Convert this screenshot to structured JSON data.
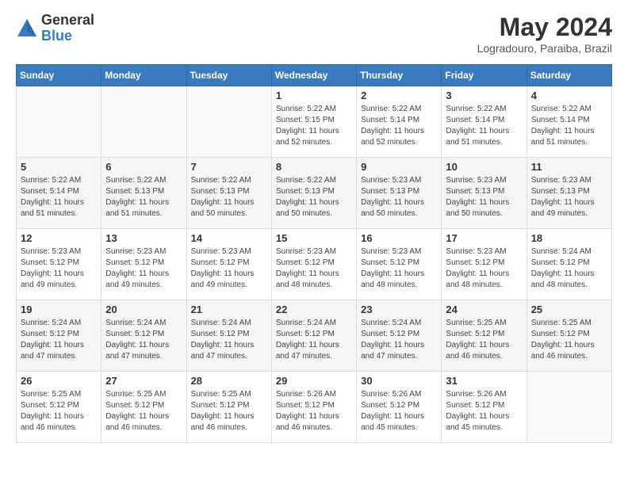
{
  "logo": {
    "general": "General",
    "blue": "Blue"
  },
  "title": "May 2024",
  "location": "Logradouro, Paraiba, Brazil",
  "days_of_week": [
    "Sunday",
    "Monday",
    "Tuesday",
    "Wednesday",
    "Thursday",
    "Friday",
    "Saturday"
  ],
  "weeks": [
    [
      {
        "day": "",
        "info": ""
      },
      {
        "day": "",
        "info": ""
      },
      {
        "day": "",
        "info": ""
      },
      {
        "day": "1",
        "info": "Sunrise: 5:22 AM\nSunset: 5:15 PM\nDaylight: 11 hours\nand 52 minutes."
      },
      {
        "day": "2",
        "info": "Sunrise: 5:22 AM\nSunset: 5:14 PM\nDaylight: 11 hours\nand 52 minutes."
      },
      {
        "day": "3",
        "info": "Sunrise: 5:22 AM\nSunset: 5:14 PM\nDaylight: 11 hours\nand 51 minutes."
      },
      {
        "day": "4",
        "info": "Sunrise: 5:22 AM\nSunset: 5:14 PM\nDaylight: 11 hours\nand 51 minutes."
      }
    ],
    [
      {
        "day": "5",
        "info": "Sunrise: 5:22 AM\nSunset: 5:14 PM\nDaylight: 11 hours\nand 51 minutes."
      },
      {
        "day": "6",
        "info": "Sunrise: 5:22 AM\nSunset: 5:13 PM\nDaylight: 11 hours\nand 51 minutes."
      },
      {
        "day": "7",
        "info": "Sunrise: 5:22 AM\nSunset: 5:13 PM\nDaylight: 11 hours\nand 50 minutes."
      },
      {
        "day": "8",
        "info": "Sunrise: 5:22 AM\nSunset: 5:13 PM\nDaylight: 11 hours\nand 50 minutes."
      },
      {
        "day": "9",
        "info": "Sunrise: 5:23 AM\nSunset: 5:13 PM\nDaylight: 11 hours\nand 50 minutes."
      },
      {
        "day": "10",
        "info": "Sunrise: 5:23 AM\nSunset: 5:13 PM\nDaylight: 11 hours\nand 50 minutes."
      },
      {
        "day": "11",
        "info": "Sunrise: 5:23 AM\nSunset: 5:13 PM\nDaylight: 11 hours\nand 49 minutes."
      }
    ],
    [
      {
        "day": "12",
        "info": "Sunrise: 5:23 AM\nSunset: 5:12 PM\nDaylight: 11 hours\nand 49 minutes."
      },
      {
        "day": "13",
        "info": "Sunrise: 5:23 AM\nSunset: 5:12 PM\nDaylight: 11 hours\nand 49 minutes."
      },
      {
        "day": "14",
        "info": "Sunrise: 5:23 AM\nSunset: 5:12 PM\nDaylight: 11 hours\nand 49 minutes."
      },
      {
        "day": "15",
        "info": "Sunrise: 5:23 AM\nSunset: 5:12 PM\nDaylight: 11 hours\nand 48 minutes."
      },
      {
        "day": "16",
        "info": "Sunrise: 5:23 AM\nSunset: 5:12 PM\nDaylight: 11 hours\nand 48 minutes."
      },
      {
        "day": "17",
        "info": "Sunrise: 5:23 AM\nSunset: 5:12 PM\nDaylight: 11 hours\nand 48 minutes."
      },
      {
        "day": "18",
        "info": "Sunrise: 5:24 AM\nSunset: 5:12 PM\nDaylight: 11 hours\nand 48 minutes."
      }
    ],
    [
      {
        "day": "19",
        "info": "Sunrise: 5:24 AM\nSunset: 5:12 PM\nDaylight: 11 hours\nand 47 minutes."
      },
      {
        "day": "20",
        "info": "Sunrise: 5:24 AM\nSunset: 5:12 PM\nDaylight: 11 hours\nand 47 minutes."
      },
      {
        "day": "21",
        "info": "Sunrise: 5:24 AM\nSunset: 5:12 PM\nDaylight: 11 hours\nand 47 minutes."
      },
      {
        "day": "22",
        "info": "Sunrise: 5:24 AM\nSunset: 5:12 PM\nDaylight: 11 hours\nand 47 minutes."
      },
      {
        "day": "23",
        "info": "Sunrise: 5:24 AM\nSunset: 5:12 PM\nDaylight: 11 hours\nand 47 minutes."
      },
      {
        "day": "24",
        "info": "Sunrise: 5:25 AM\nSunset: 5:12 PM\nDaylight: 11 hours\nand 46 minutes."
      },
      {
        "day": "25",
        "info": "Sunrise: 5:25 AM\nSunset: 5:12 PM\nDaylight: 11 hours\nand 46 minutes."
      }
    ],
    [
      {
        "day": "26",
        "info": "Sunrise: 5:25 AM\nSunset: 5:12 PM\nDaylight: 11 hours\nand 46 minutes."
      },
      {
        "day": "27",
        "info": "Sunrise: 5:25 AM\nSunset: 5:12 PM\nDaylight: 11 hours\nand 46 minutes."
      },
      {
        "day": "28",
        "info": "Sunrise: 5:25 AM\nSunset: 5:12 PM\nDaylight: 11 hours\nand 46 minutes."
      },
      {
        "day": "29",
        "info": "Sunrise: 5:26 AM\nSunset: 5:12 PM\nDaylight: 11 hours\nand 46 minutes."
      },
      {
        "day": "30",
        "info": "Sunrise: 5:26 AM\nSunset: 5:12 PM\nDaylight: 11 hours\nand 45 minutes."
      },
      {
        "day": "31",
        "info": "Sunrise: 5:26 AM\nSunset: 5:12 PM\nDaylight: 11 hours\nand 45 minutes."
      },
      {
        "day": "",
        "info": ""
      }
    ]
  ]
}
